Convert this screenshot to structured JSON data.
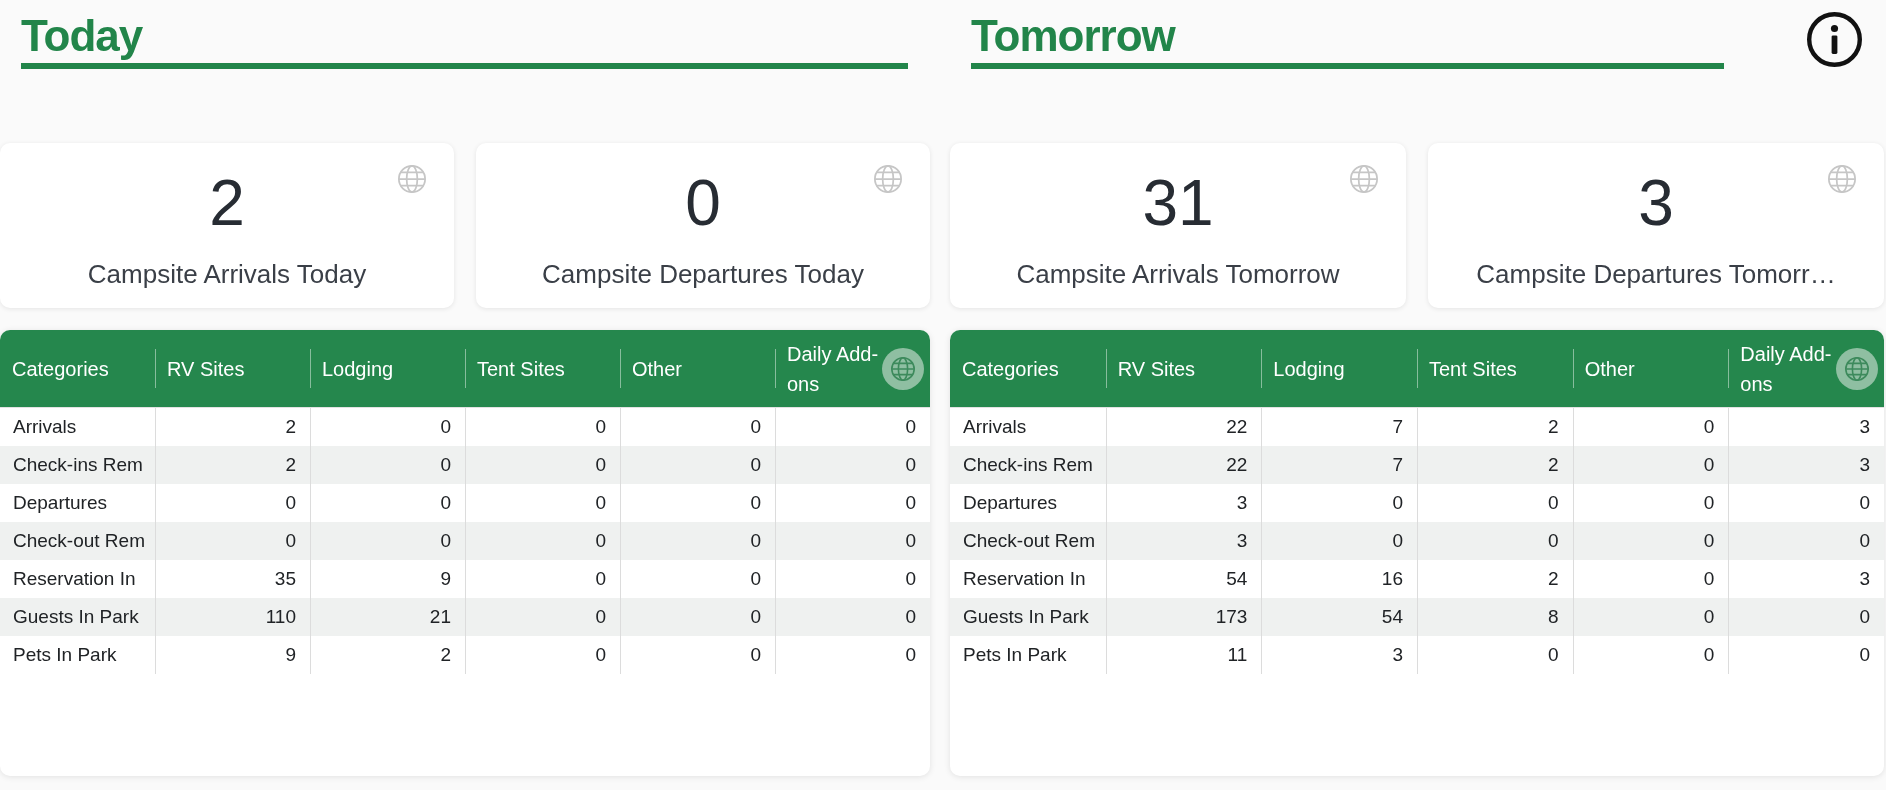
{
  "sections": [
    {
      "title": "Today",
      "cards": [
        {
          "value": "2",
          "label": "Campsite Arrivals Today"
        },
        {
          "value": "0",
          "label": "Campsite Departures Today"
        }
      ],
      "table": {
        "columns": [
          "Categories",
          "RV Sites",
          "Lodging",
          "Tent Sites",
          "Other",
          "Daily Add-ons"
        ],
        "rows": [
          [
            "Arrivals",
            "2",
            "0",
            "0",
            "0",
            "0"
          ],
          [
            "Check-ins Rem",
            "2",
            "0",
            "0",
            "0",
            "0"
          ],
          [
            "Departures",
            "0",
            "0",
            "0",
            "0",
            "0"
          ],
          [
            "Check-out Rem",
            "0",
            "0",
            "0",
            "0",
            "0"
          ],
          [
            "Reservation In",
            "35",
            "9",
            "0",
            "0",
            "0"
          ],
          [
            "Guests In Park",
            "110",
            "21",
            "0",
            "0",
            "0"
          ],
          [
            "Pets In Park",
            "9",
            "2",
            "0",
            "0",
            "0"
          ]
        ]
      }
    },
    {
      "title": "Tomorrow",
      "cards": [
        {
          "value": "31",
          "label": "Campsite Arrivals Tomorrow"
        },
        {
          "value": "3",
          "label": "Campsite Departures Tomorr…"
        }
      ],
      "table": {
        "columns": [
          "Categories",
          "RV Sites",
          "Lodging",
          "Tent Sites",
          "Other",
          "Daily Add-ons"
        ],
        "rows": [
          [
            "Arrivals",
            "22",
            "7",
            "2",
            "0",
            "3"
          ],
          [
            "Check-ins Rem",
            "22",
            "7",
            "2",
            "0",
            "3"
          ],
          [
            "Departures",
            "3",
            "0",
            "0",
            "0",
            "0"
          ],
          [
            "Check-out Rem",
            "3",
            "0",
            "0",
            "0",
            "0"
          ],
          [
            "Reservation In",
            "54",
            "16",
            "2",
            "0",
            "3"
          ],
          [
            "Guests In Park",
            "173",
            "54",
            "8",
            "0",
            "0"
          ],
          [
            "Pets In Park",
            "11",
            "3",
            "0",
            "0",
            "0"
          ]
        ]
      }
    }
  ]
}
